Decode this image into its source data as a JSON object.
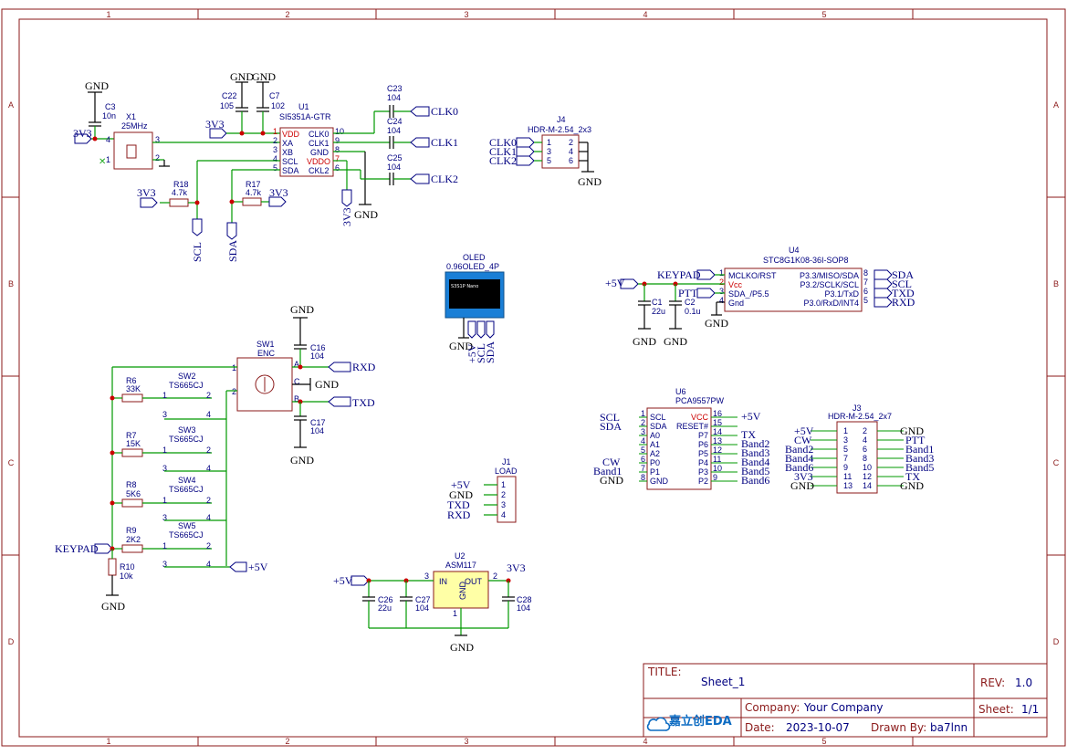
{
  "zones": {
    "cols": [
      "1",
      "2",
      "3",
      "4",
      "5"
    ],
    "rows": [
      "A",
      "B",
      "C",
      "D"
    ]
  },
  "nets": {
    "gnd": "GND",
    "v33": "3V3",
    "v5": "+5V",
    "clk0": "CLK0",
    "clk1": "CLK1",
    "clk2": "CLK2",
    "scl": "SCL",
    "sda": "SDA",
    "rxd": "RXD",
    "txd": "TXD",
    "keypad": "KEYPAD",
    "ptt": "PTT",
    "tx": "TX",
    "cw": "CW",
    "band1": "Band1",
    "band2": "Band2",
    "band3": "Band3",
    "band4": "Band4",
    "band5": "Band5",
    "band6": "Band6"
  },
  "c3": {
    "ref": "C3",
    "val": "10n"
  },
  "x1": {
    "ref": "X1",
    "val": "25MHz",
    "p1": "1",
    "p2": "2",
    "p3": "3",
    "p4": "4"
  },
  "c22": {
    "ref": "C22",
    "val": "105"
  },
  "c7": {
    "ref": "C7",
    "val": "102"
  },
  "u1": {
    "ref": "U1",
    "val": "SI5351A-GTR",
    "l1": "VDD",
    "l2": "XA",
    "l3": "XB",
    "l4": "SCL",
    "l5": "SDA",
    "r1": "CLK0",
    "r2": "CLK1",
    "r3": "GND",
    "r4": "VDDO",
    "r5": "CKL2",
    "n1": "1",
    "n2": "2",
    "n3": "3",
    "n4": "4",
    "n5": "5",
    "n10": "10",
    "n9": "9",
    "n8": "8",
    "n7": "7",
    "n6": "6"
  },
  "c23": {
    "ref": "C23",
    "val": "104"
  },
  "c24": {
    "ref": "C24",
    "val": "104"
  },
  "c25": {
    "ref": "C25",
    "val": "104"
  },
  "r18": {
    "ref": "R18",
    "val": "4.7k"
  },
  "r17": {
    "ref": "R17",
    "val": "4.7k"
  },
  "j4": {
    "ref": "J4",
    "val": "HDR-M-2.54_2x3",
    "p": [
      "1",
      "2",
      "3",
      "4",
      "5",
      "6"
    ]
  },
  "oled": {
    "ref": "OLED",
    "val": "0.96OLED_4P",
    "screen": "S3S1P Nano"
  },
  "u4": {
    "ref": "U4",
    "val": "STC8G1K08-36I-SOP8",
    "l1": "MCLKO/RST",
    "l2": "Vcc",
    "l3": "SDA_/P5.5",
    "l4": "Gnd",
    "r1": "P3.3/MISO/SDA",
    "r2": "P3.2/SCLK/SCL",
    "r3": "P3.1/TxD",
    "r4": "P3.0/RxD/INT4",
    "n": [
      "1",
      "2",
      "3",
      "4",
      "8",
      "7",
      "6",
      "5"
    ]
  },
  "c1": {
    "ref": "C1",
    "val": "22u"
  },
  "c2": {
    "ref": "C2",
    "val": "0.1u"
  },
  "sw1": {
    "ref": "SW1",
    "val": "ENC",
    "pa": "A",
    "pb": "B",
    "pc": "C",
    "p1": "1",
    "p2": "2"
  },
  "c16": {
    "ref": "C16",
    "val": "104"
  },
  "c17": {
    "ref": "C17",
    "val": "104"
  },
  "r6": {
    "ref": "R6",
    "val": "33K"
  },
  "r7": {
    "ref": "R7",
    "val": "15K"
  },
  "r8": {
    "ref": "R8",
    "val": "5K6"
  },
  "r9": {
    "ref": "R9",
    "val": "2K2"
  },
  "r10": {
    "ref": "R10",
    "val": "10k"
  },
  "sw2": {
    "ref": "SW2",
    "val": "TS665CJ"
  },
  "sw3": {
    "ref": "SW3",
    "val": "TS665CJ"
  },
  "sw4": {
    "ref": "SW4",
    "val": "TS665CJ"
  },
  "sw5": {
    "ref": "SW5",
    "val": "TS665CJ"
  },
  "swpins": {
    "p1": "1",
    "p2": "2",
    "p3": "3",
    "p4": "4"
  },
  "u6": {
    "ref": "U6",
    "val": "PCA9557PW",
    "l": [
      "SCL",
      "SDA",
      "A0",
      "A1",
      "A2",
      "P0",
      "P1",
      "GND"
    ],
    "r": [
      "VCC",
      "RESET#",
      "P7",
      "P6",
      "P5",
      "P4",
      "P3",
      "P2"
    ],
    "nl": [
      "1",
      "2",
      "3",
      "4",
      "5",
      "6",
      "7",
      "8"
    ],
    "nr": [
      "16",
      "15",
      "14",
      "13",
      "12",
      "11",
      "10",
      "9"
    ]
  },
  "j1": {
    "ref": "J1",
    "val": "LOAD",
    "p": [
      "1",
      "2",
      "3",
      "4"
    ]
  },
  "u2": {
    "ref": "U2",
    "val": "ASM117",
    "in": "IN",
    "out": "OUT",
    "gnd": "GND",
    "p1": "1",
    "p2": "2",
    "p3": "3"
  },
  "c26": {
    "ref": "C26",
    "val": "22u"
  },
  "c27": {
    "ref": "C27",
    "val": "104"
  },
  "c28": {
    "ref": "C28",
    "val": "104"
  },
  "j3": {
    "ref": "J3",
    "val": "HDR-M-2.54_2x7",
    "p": [
      "1",
      "2",
      "3",
      "4",
      "5",
      "6",
      "7",
      "8",
      "9",
      "10",
      "11",
      "12",
      "13",
      "14"
    ]
  },
  "title_block": {
    "title_label": "TITLE:",
    "title": "Sheet_1",
    "rev_label": "REV:",
    "rev": "1.0",
    "company_label": "Company:",
    "company": "Your Company",
    "sheet_label": "Sheet:",
    "sheet": "1/1",
    "date_label": "Date:",
    "date": "2023-10-07",
    "drawn_label": "Drawn By:",
    "drawn": "ba7lnn",
    "logo": "嘉立创EDA",
    "logo_color": "#0c6bc2"
  }
}
